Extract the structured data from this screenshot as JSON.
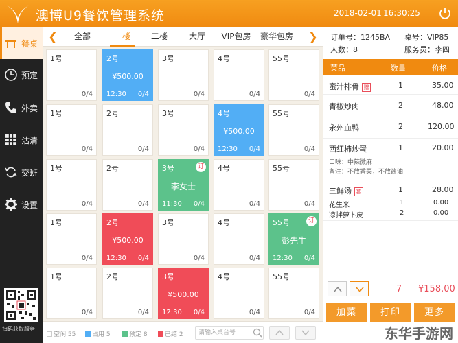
{
  "header": {
    "app_title": "澳博U9餐饮管理系统",
    "date": "2018-02-01",
    "time": "16:30:25"
  },
  "sidebar": {
    "items": [
      {
        "label": "餐桌",
        "icon": "dining-table-icon"
      },
      {
        "label": "预定",
        "icon": "clock-icon"
      },
      {
        "label": "外卖",
        "icon": "phone-icon"
      },
      {
        "label": "沽清",
        "icon": "grid-icon"
      },
      {
        "label": "交班",
        "icon": "refresh-icon"
      },
      {
        "label": "设置",
        "icon": "gear-icon"
      }
    ],
    "qr_label": "扫码获取服务"
  },
  "tabs": [
    "全部",
    "一楼",
    "二楼",
    "大厅",
    "VIP包房",
    "豪华包房"
  ],
  "active_tab": "一楼",
  "tables": [
    [
      {
        "num": "1号",
        "cap": "0/4"
      },
      {
        "num": "2号",
        "cap": "0/4",
        "status": "occupied",
        "amount": "¥500.00",
        "time": "12:30"
      },
      {
        "num": "3号",
        "cap": "0/4"
      },
      {
        "num": "4号",
        "cap": "0/4"
      },
      {
        "num": "55号",
        "cap": "0/4"
      }
    ],
    [
      {
        "num": "1号",
        "cap": "0/4"
      },
      {
        "num": "2号",
        "cap": "0/4"
      },
      {
        "num": "3号",
        "cap": "0/4"
      },
      {
        "num": "4号",
        "cap": "0/4",
        "status": "occupied",
        "amount": "¥500.00",
        "time": "12:30"
      },
      {
        "num": "55号",
        "cap": "0/4"
      }
    ],
    [
      {
        "num": "1号",
        "cap": "0/4"
      },
      {
        "num": "2号",
        "cap": "0/4"
      },
      {
        "num": "3号",
        "cap": "0/4",
        "status": "reserved",
        "guest": "李女士",
        "time": "11:30",
        "badge": "订"
      },
      {
        "num": "4号",
        "cap": "0/4"
      },
      {
        "num": "55号",
        "cap": "0/4"
      }
    ],
    [
      {
        "num": "1号",
        "cap": "0/4"
      },
      {
        "num": "2号",
        "cap": "0/4",
        "status": "settled",
        "amount": "¥500.00",
        "time": "12:30"
      },
      {
        "num": "3号",
        "cap": "0/4"
      },
      {
        "num": "4号",
        "cap": "0/4"
      },
      {
        "num": "55号",
        "cap": "0/4",
        "status": "reserved",
        "guest": "彭先生",
        "time": "12:30",
        "badge": "订"
      }
    ],
    [
      {
        "num": "1号",
        "cap": "0/4"
      },
      {
        "num": "2号",
        "cap": "0/4"
      },
      {
        "num": "3号",
        "cap": "0/4",
        "status": "settled",
        "amount": "¥500.00",
        "time": "12:30"
      },
      {
        "num": "4号",
        "cap": "0/4"
      },
      {
        "num": "55号",
        "cap": "0/4"
      }
    ]
  ],
  "legend": [
    {
      "label": "空闲 55",
      "color": "#ffffff"
    },
    {
      "label": "占用 5",
      "color": "#52aef5"
    },
    {
      "label": "预定 8",
      "color": "#5cc28b"
    },
    {
      "label": "已结 2",
      "color": "#f04c58"
    }
  ],
  "search": {
    "placeholder": "请输入桌台号"
  },
  "order": {
    "order_no": "订单号：1245BA",
    "table_no": "桌号：VIP85",
    "people": "人数：8",
    "waiter": "服务员：李四",
    "headers": {
      "dish": "菜品",
      "qty": "数量",
      "price": "价格"
    },
    "items": [
      {
        "name": "蜜汁排骨",
        "tag": "赠",
        "qty": "1",
        "price": "35.00"
      },
      {
        "name": "青椒炒肉",
        "qty": "2",
        "price": "48.00"
      },
      {
        "name": "永州血鸭",
        "qty": "2",
        "price": "120.00"
      },
      {
        "name": "西红柿炒蛋",
        "qty": "1",
        "price": "20.00",
        "taste": "口味：中辣微麻",
        "note": "备注：不放香菜，不放酱油"
      },
      {
        "name": "三鲜汤",
        "tag": "套",
        "qty": "1",
        "price": "28.00",
        "subs": [
          {
            "name": "花生米",
            "qty": "1",
            "price": "0.00"
          },
          {
            "name": "凉拌萝卜皮",
            "qty": "2",
            "price": "0.00"
          }
        ]
      }
    ],
    "total_count": "7",
    "total_amount": "¥158.00"
  },
  "actions": [
    "加菜",
    "打印",
    "更多"
  ],
  "watermark": "东华手游网",
  "colors": {
    "accent": "#f08a10",
    "occupied": "#52aef5",
    "reserved": "#5cc28b",
    "settled": "#f04c58"
  }
}
